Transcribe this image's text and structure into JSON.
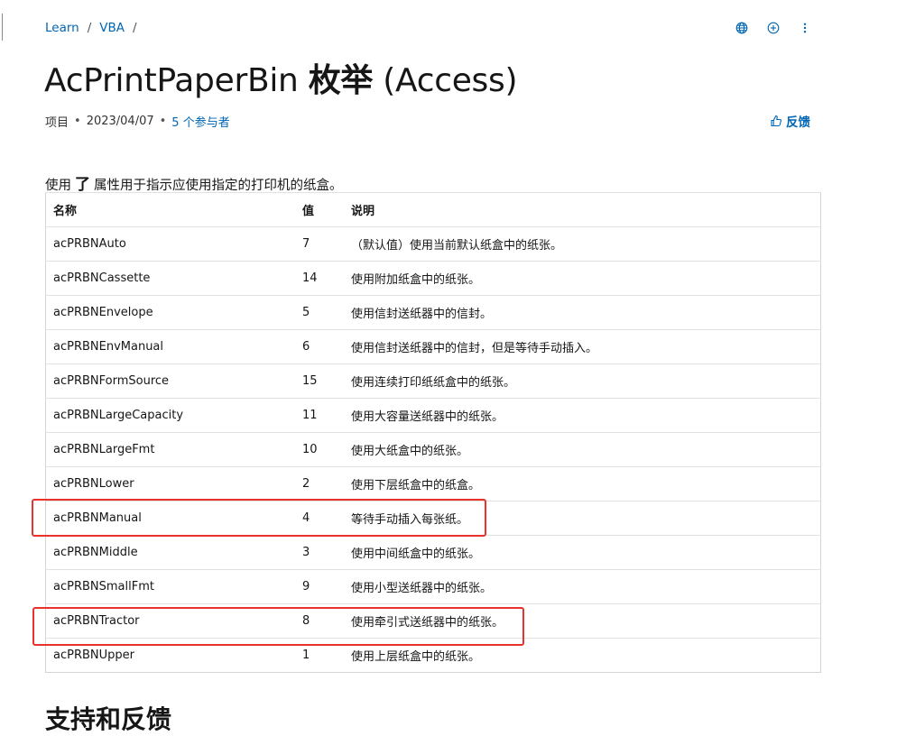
{
  "breadcrumb": {
    "items": [
      "Learn",
      "VBA"
    ],
    "sep": "/"
  },
  "header_icons": [
    "globe-icon",
    "add-circle-icon",
    "more-vertical-icon"
  ],
  "title": {
    "main": "AcPrintPaperBin ",
    "bold": "枚举",
    "suffix": " (Access)"
  },
  "meta": {
    "type": "项目",
    "date": "2023/04/07",
    "contributors": "5 个参与者",
    "dot": "•"
  },
  "feedback": {
    "label": "反馈"
  },
  "intro": {
    "before": "使用",
    "code": "了",
    "after": "属性用于指示应使用指定的打印机的纸盒。"
  },
  "table": {
    "headers": [
      "名称",
      "值",
      "说明"
    ],
    "rows": [
      [
        "acPRBNAuto",
        "7",
        "（默认值）使用当前默认纸盒中的纸张。"
      ],
      [
        "acPRBNCassette",
        "14",
        "使用附加纸盒中的纸张。"
      ],
      [
        "acPRBNEnvelope",
        "5",
        "使用信封送纸器中的信封。"
      ],
      [
        "acPRBNEnvManual",
        "6",
        "使用信封送纸器中的信封，但是等待手动插入。"
      ],
      [
        "acPRBNFormSource",
        "15",
        "使用连续打印纸纸盒中的纸张。"
      ],
      [
        "acPRBNLargeCapacity",
        "11",
        "使用大容量送纸器中的纸张。"
      ],
      [
        "acPRBNLargeFmt",
        "10",
        "使用大纸盒中的纸张。"
      ],
      [
        "acPRBNLower",
        "2",
        "使用下层纸盒中的纸盒。"
      ],
      [
        "acPRBNManual",
        "4",
        "等待手动插入每张纸。"
      ],
      [
        "acPRBNMiddle",
        "3",
        "使用中间纸盒中的纸张。"
      ],
      [
        "acPRBNSmallFmt",
        "9",
        "使用小型送纸器中的纸张。"
      ],
      [
        "acPRBNTractor",
        "8",
        "使用牵引式送纸器中的纸张。"
      ],
      [
        "acPRBNUpper",
        "1",
        "使用上层纸盒中的纸张。"
      ]
    ]
  },
  "next_heading": "支持和反馈",
  "colors": {
    "link": "#0065b3",
    "highlight": "#e8322b",
    "border": "#d4d4d4"
  }
}
